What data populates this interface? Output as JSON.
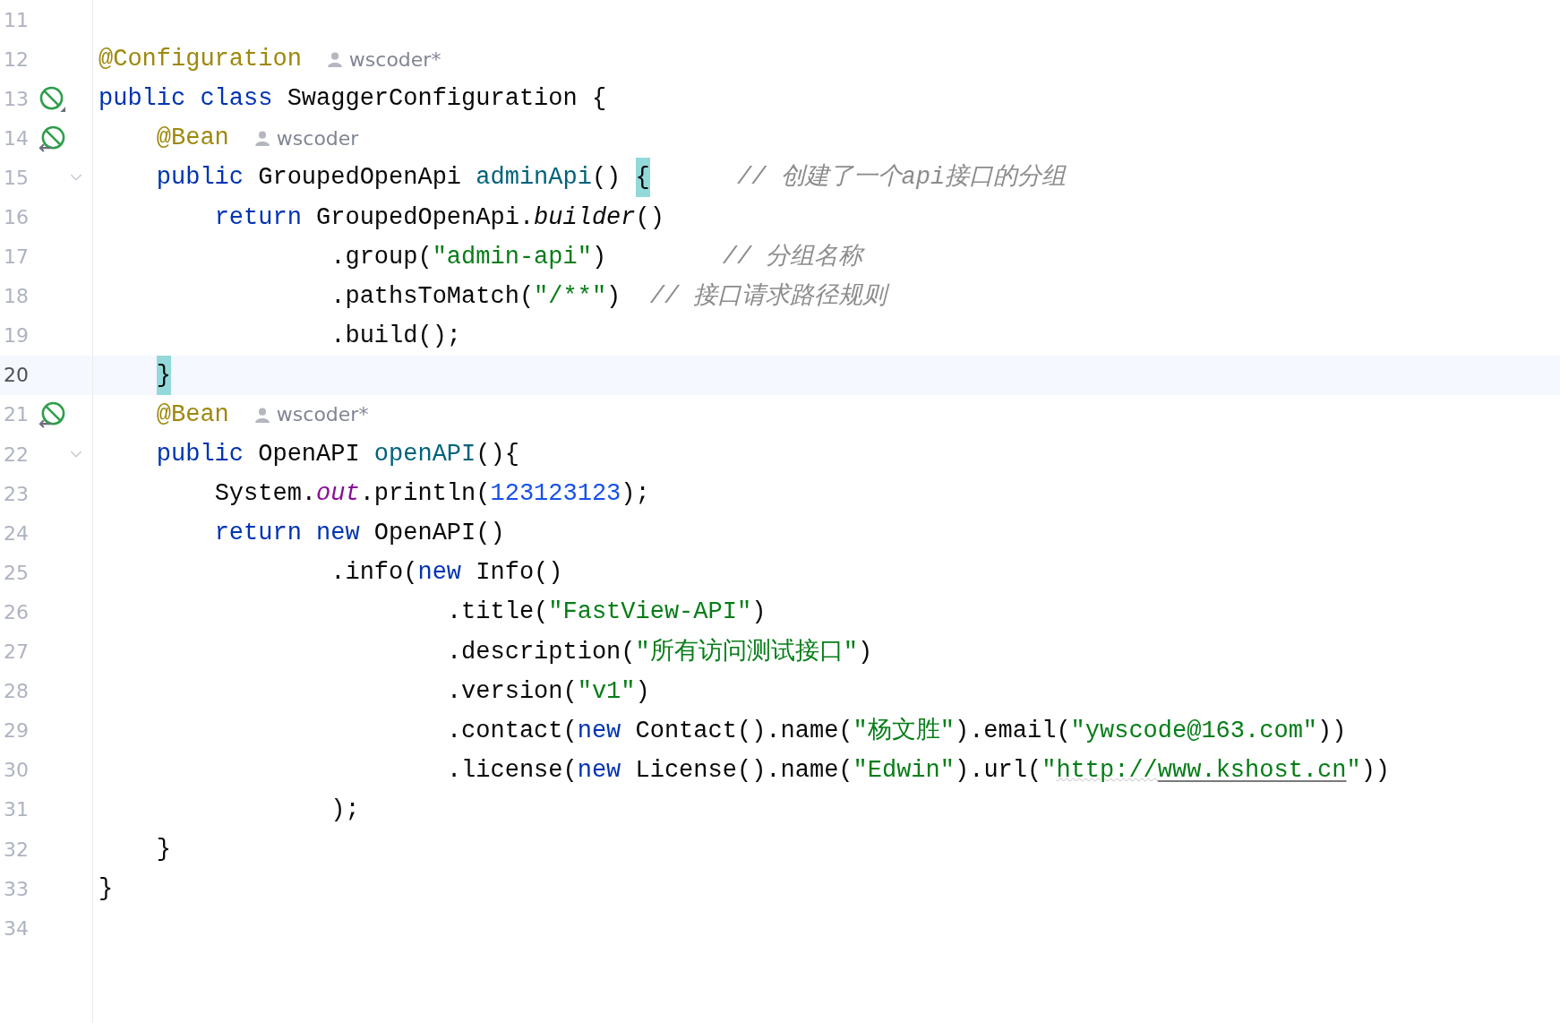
{
  "editor": {
    "lines": [
      {
        "number": "11",
        "current": false
      },
      {
        "number": "12",
        "current": false,
        "tokens": [
          {
            "kind": "annotation",
            "text": "@Configuration"
          }
        ],
        "inlay": {
          "author": "wscoder*"
        }
      },
      {
        "number": "13",
        "current": false,
        "gutter": {
          "kind": "class"
        },
        "tokens": [
          {
            "kind": "keyword",
            "text": "public"
          },
          {
            "kind": "keyword",
            "text": " class"
          },
          {
            "kind": "plain",
            "text": " SwaggerConfiguration {"
          }
        ]
      },
      {
        "number": "14",
        "current": false,
        "gutter": {
          "kind": "bean"
        },
        "tokens": [
          {
            "kind": "annotation",
            "text": "    @Bean"
          }
        ],
        "inlay": {
          "author": "wscoder"
        }
      },
      {
        "number": "15",
        "current": false,
        "fold": true,
        "tokens": [
          {
            "kind": "keyword",
            "text": "    public"
          },
          {
            "kind": "plain",
            "text": " GroupedOpenApi "
          },
          {
            "kind": "method",
            "text": "adminApi"
          },
          {
            "kind": "plain",
            "text": "() "
          },
          {
            "kind": "brace",
            "text": "{"
          },
          {
            "kind": "comment",
            "text": "      // 创建了一个api接口的分组"
          }
        ]
      },
      {
        "number": "16",
        "current": false,
        "tokens": [
          {
            "kind": "keyword",
            "text": "        return"
          },
          {
            "kind": "plain",
            "text": " GroupedOpenApi."
          },
          {
            "kind": "static-method",
            "text": "builder"
          },
          {
            "kind": "plain",
            "text": "()"
          }
        ]
      },
      {
        "number": "17",
        "current": false,
        "tokens": [
          {
            "kind": "plain",
            "text": "                .group("
          },
          {
            "kind": "string",
            "text": "\"admin-api\""
          },
          {
            "kind": "plain",
            "text": ")"
          },
          {
            "kind": "comment",
            "text": "        // 分组名称"
          }
        ]
      },
      {
        "number": "18",
        "current": false,
        "tokens": [
          {
            "kind": "plain",
            "text": "                .pathsToMatch("
          },
          {
            "kind": "string",
            "text": "\"/**\""
          },
          {
            "kind": "plain",
            "text": ")"
          },
          {
            "kind": "comment",
            "text": "  // 接口请求路径规则"
          }
        ]
      },
      {
        "number": "19",
        "current": false,
        "tokens": [
          {
            "kind": "plain",
            "text": "                .build();"
          }
        ]
      },
      {
        "number": "20",
        "current": true,
        "tokens": [
          {
            "kind": "brace",
            "text": "    }"
          }
        ]
      },
      {
        "number": "21",
        "current": false,
        "gutter": {
          "kind": "bean"
        },
        "tokens": [
          {
            "kind": "annotation",
            "text": "    @Bean"
          }
        ],
        "inlay": {
          "author": "wscoder*"
        }
      },
      {
        "number": "22",
        "current": false,
        "fold": true,
        "tokens": [
          {
            "kind": "keyword",
            "text": "    public"
          },
          {
            "kind": "plain",
            "text": " OpenAPI "
          },
          {
            "kind": "method",
            "text": "openAPI"
          },
          {
            "kind": "plain",
            "text": "(){"
          }
        ]
      },
      {
        "number": "23",
        "current": false,
        "tokens": [
          {
            "kind": "plain",
            "text": "        System."
          },
          {
            "kind": "static-field",
            "text": "out"
          },
          {
            "kind": "plain",
            "text": ".println("
          },
          {
            "kind": "number",
            "text": "123123123"
          },
          {
            "kind": "plain",
            "text": ");"
          }
        ]
      },
      {
        "number": "24",
        "current": false,
        "tokens": [
          {
            "kind": "keyword",
            "text": "        return"
          },
          {
            "kind": "keyword",
            "text": " new"
          },
          {
            "kind": "plain",
            "text": " OpenAPI()"
          }
        ]
      },
      {
        "number": "25",
        "current": false,
        "tokens": [
          {
            "kind": "plain",
            "text": "                .info("
          },
          {
            "kind": "keyword",
            "text": "new"
          },
          {
            "kind": "plain",
            "text": " Info()"
          }
        ]
      },
      {
        "number": "26",
        "current": false,
        "tokens": [
          {
            "kind": "plain",
            "text": "                        .title("
          },
          {
            "kind": "string",
            "text": "\"FastView-API\""
          },
          {
            "kind": "plain",
            "text": ")"
          }
        ]
      },
      {
        "number": "27",
        "current": false,
        "tokens": [
          {
            "kind": "plain",
            "text": "                        .description("
          },
          {
            "kind": "string",
            "text": "\"所有访问测试接口\""
          },
          {
            "kind": "plain",
            "text": ")"
          }
        ]
      },
      {
        "number": "28",
        "current": false,
        "tokens": [
          {
            "kind": "plain",
            "text": "                        .version("
          },
          {
            "kind": "string",
            "text": "\"v1\""
          },
          {
            "kind": "plain",
            "text": ")"
          }
        ]
      },
      {
        "number": "29",
        "current": false,
        "tokens": [
          {
            "kind": "plain",
            "text": "                        .contact("
          },
          {
            "kind": "keyword",
            "text": "new"
          },
          {
            "kind": "plain",
            "text": " Contact().name("
          },
          {
            "kind": "string",
            "text": "\"杨文胜\""
          },
          {
            "kind": "plain",
            "text": ").email("
          },
          {
            "kind": "string",
            "text": "\"ywscode@163.com\""
          },
          {
            "kind": "plain",
            "text": "))"
          }
        ]
      },
      {
        "number": "30",
        "current": false,
        "tokens": [
          {
            "kind": "plain",
            "text": "                        .license("
          },
          {
            "kind": "keyword",
            "text": "new"
          },
          {
            "kind": "plain",
            "text": " License().name("
          },
          {
            "kind": "string",
            "text": "\"Edwin\""
          },
          {
            "kind": "plain",
            "text": ").url("
          },
          {
            "kind": "string",
            "text": "\""
          },
          {
            "kind": "typo",
            "text": "http://"
          },
          {
            "kind": "link",
            "text": "www.kshost.cn"
          },
          {
            "kind": "string",
            "text": "\""
          },
          {
            "kind": "plain",
            "text": "))"
          }
        ]
      },
      {
        "number": "31",
        "current": false,
        "tokens": [
          {
            "kind": "plain",
            "text": "                );"
          }
        ]
      },
      {
        "number": "32",
        "current": false,
        "tokens": [
          {
            "kind": "plain",
            "text": "    }"
          }
        ]
      },
      {
        "number": "33",
        "current": false,
        "tokens": [
          {
            "kind": "plain",
            "text": "}"
          }
        ]
      },
      {
        "number": "34",
        "current": false
      }
    ]
  }
}
